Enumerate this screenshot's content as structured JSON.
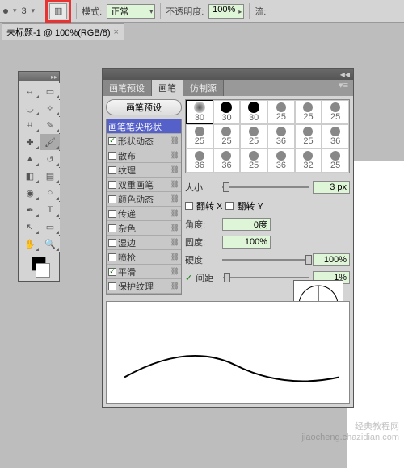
{
  "top": {
    "size_num": "3",
    "mode_label": "模式:",
    "mode_value": "正常",
    "opacity_label": "不透明度:",
    "opacity_value": "100%",
    "flow_label": "流:"
  },
  "document": {
    "tab_title": "未标题-1 @ 100%(RGB/8)",
    "close": "×"
  },
  "panel": {
    "tabs": {
      "presets": "画笔预设",
      "brush": "画笔",
      "clone": "仿制源"
    },
    "preset_button": "画笔预设",
    "options": {
      "tip_shape": "画笔笔尖形状",
      "shape_dynamics": "形状动态",
      "scatter": "散布",
      "texture": "纹理",
      "dual_brush": "双重画笔",
      "color_dynamics": "颜色动态",
      "transfer": "传递",
      "noise": "杂色",
      "wet_edges": "湿边",
      "airbrush": "喷枪",
      "smoothing": "平滑",
      "protect_texture": "保护纹理"
    },
    "preset_sizes": [
      "30",
      "30",
      "30",
      "25",
      "25",
      "25",
      "25",
      "25",
      "25",
      "36",
      "25",
      "36",
      "36",
      "36",
      "25",
      "36",
      "32",
      "25"
    ],
    "settings": {
      "size_label": "大小",
      "size_value": "3 px",
      "flipx": "翻转 X",
      "flipy": "翻转 Y",
      "angle_label": "角度:",
      "angle_value": "0度",
      "roundness_label": "圆度:",
      "roundness_value": "100%",
      "hardness_label": "硬度",
      "hardness_value": "100%",
      "spacing_label": "间距",
      "spacing_value": "1%"
    }
  },
  "watermark": {
    "line1": "经典教程网",
    "line2": "jiaocheng.chazidian.com"
  }
}
